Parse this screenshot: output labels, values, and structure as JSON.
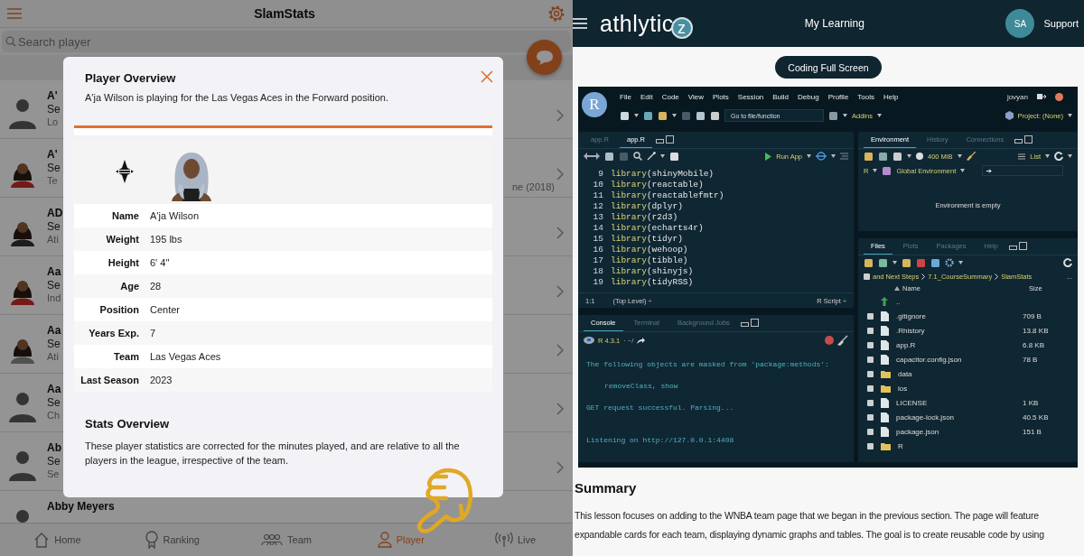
{
  "slamstats": {
    "title": "SlamStats",
    "search": {
      "placeholder": "Search player"
    },
    "players": [
      {
        "name": "A'",
        "line_2": "Se",
        "line_3": "Lo",
        "kind": "silhouette"
      },
      {
        "name": "A'",
        "line_2": "Se",
        "line_3": "Te",
        "line_3_end": "ne (2018)"
      },
      {
        "name": "AD",
        "line_2": "Se",
        "line_3": "Ati"
      },
      {
        "name": "Aa",
        "line_2": "Se",
        "line_3": "Ind"
      },
      {
        "name": "Aa",
        "line_2": "Se",
        "line_3": "Ati"
      },
      {
        "name": "Aa",
        "line_2": "Se",
        "line_3": "Ch",
        "kind": "silhouette"
      },
      {
        "name": "Ab",
        "line_2": "Se",
        "line_3": "Se",
        "kind": "silhouette"
      },
      {
        "name": "Abby Meyers",
        "kind": "silhouette"
      }
    ],
    "modal": {
      "title": "Player Overview",
      "subtitle": "A'ja Wilson is playing for the Las Vegas Aces in the Forward position.",
      "details": [
        {
          "label": "Name",
          "value": "A'ja Wilson"
        },
        {
          "label": "Weight",
          "value": "195 lbs"
        },
        {
          "label": "Height",
          "value": "6' 4\""
        },
        {
          "label": "Age",
          "value": "28"
        },
        {
          "label": "Position",
          "value": "Center"
        },
        {
          "label": "Years Exp.",
          "value": "7"
        },
        {
          "label": "Team",
          "value": "Las Vegas Aces"
        },
        {
          "label": "Last Season",
          "value": "2023"
        }
      ],
      "stats_title": "Stats Overview",
      "stats_text": "These player statistics are corrected for the minutes played, and are relative to all the players in the league, irrespective of the team."
    },
    "tabs": [
      {
        "label": "Home",
        "selected": false
      },
      {
        "label": "Ranking",
        "selected": false
      },
      {
        "label": "Team",
        "selected": false
      },
      {
        "label": "Player",
        "selected": true
      },
      {
        "label": "Live",
        "selected": false
      }
    ]
  },
  "athlyticz": {
    "logo": {
      "text": "athlytic",
      "badge": "z"
    },
    "nav_title": "My Learning",
    "avatar": "SA",
    "support": "Support",
    "coding_button": "Coding Full Screen",
    "rstudio": {
      "logo": "R",
      "menus": [
        "File",
        "Edit",
        "Code",
        "View",
        "Plots",
        "Session",
        "Build",
        "Debug",
        "Profile",
        "Tools",
        "Help"
      ],
      "user": "jovyan",
      "goto": {
        "placeholder": "Go to file/function"
      },
      "addins": "Addins",
      "project": "Project: (None)",
      "editor": {
        "tabs": [
          {
            "label": "app.R",
            "selected": false
          },
          {
            "label": "app.R",
            "selected": true
          }
        ],
        "run_app": "Run App",
        "lines": [
          {
            "number": "9",
            "code": "library(shinyMobile)"
          },
          {
            "number": "10",
            "code": "library(reactable)"
          },
          {
            "number": "11",
            "code": "library(reactablefmtr)"
          },
          {
            "number": "12",
            "code": "library(dplyr)"
          },
          {
            "number": "13",
            "code": "library(r2d3)"
          },
          {
            "number": "14",
            "code": "library(echarts4r)"
          },
          {
            "number": "15",
            "code": "library(tidyr)"
          },
          {
            "number": "16",
            "code": "library(wehoop)"
          },
          {
            "number": "17",
            "code": "library(tibble)"
          },
          {
            "number": "18",
            "code": "library(shinyjs)"
          },
          {
            "number": "19",
            "code": "library(tidyRSS)"
          }
        ],
        "position": "1:1",
        "scope": "(Top Level) ÷",
        "file_type": "R Script ÷"
      },
      "console": {
        "tabs": [
          {
            "label": "Console",
            "selected": true
          },
          {
            "label": "Terminal",
            "selected": false
          },
          {
            "label": "Background Jobs",
            "selected": false
          }
        ],
        "version": "R 4.3.1",
        "path": "· ~/",
        "lines": [
          {
            "text": "The following objects are masked from 'package:methods':",
            "kind": "plain"
          },
          {
            "text": "removeClass, show",
            "kind": "indent"
          },
          {
            "text": "GET request successful. Parsing...",
            "kind": "plain"
          },
          {
            "text": "Listening on http://127.0.0.1:4408",
            "kind": "gap"
          }
        ]
      },
      "environment": {
        "tabs": [
          {
            "label": "Environment",
            "selected": true
          },
          {
            "label": "History",
            "selected": false
          },
          {
            "label": "Connections",
            "selected": false
          }
        ],
        "memory": "400 MiB",
        "view": "List",
        "language": "R",
        "scope": "Global Environment",
        "empty_text": "Environment is empty"
      },
      "files": {
        "tabs": [
          {
            "label": "Files",
            "selected": true
          },
          {
            "label": "Plots",
            "selected": false
          },
          {
            "label": "Packages",
            "selected": false
          },
          {
            "label": "Help",
            "selected": false
          }
        ],
        "select_all": {
          "checked": false
        },
        "path": [
          "and Next Steps",
          "7.1_CourseSummary",
          "SlamStats"
        ],
        "more": "...",
        "name_header": "Name",
        "size_header": "Size",
        "items": [
          {
            "name": "..",
            "kind": "parent"
          },
          {
            "name": ".gitignore",
            "size": "709 B",
            "kind": "file",
            "checked": false
          },
          {
            "name": ".Rhistory",
            "size": "13.8 KB",
            "kind": "file",
            "checked": false
          },
          {
            "name": "app.R",
            "size": "6.8 KB",
            "kind": "file",
            "checked": false
          },
          {
            "name": "capacitor.config.json",
            "size": "78 B",
            "kind": "file",
            "checked": false
          },
          {
            "name": "data",
            "kind": "folder",
            "checked": false
          },
          {
            "name": "ios",
            "kind": "folder",
            "checked": false
          },
          {
            "name": "LICENSE",
            "size": "1 KB",
            "kind": "file",
            "checked": false
          },
          {
            "name": "package-lock.json",
            "size": "40.5 KB",
            "kind": "file",
            "checked": false
          },
          {
            "name": "package.json",
            "size": "151 B",
            "kind": "file",
            "checked": false
          },
          {
            "name": "R",
            "kind": "folder",
            "checked": false
          }
        ]
      }
    },
    "summary": {
      "title": "Summary",
      "lines": [
        "This lesson focuses on adding to the WNBA team page that we began in the previous section. The page will feature",
        "expandable cards for each team, displaying dynamic graphs and tables. The goal is to create reusable code by using"
      ]
    }
  }
}
